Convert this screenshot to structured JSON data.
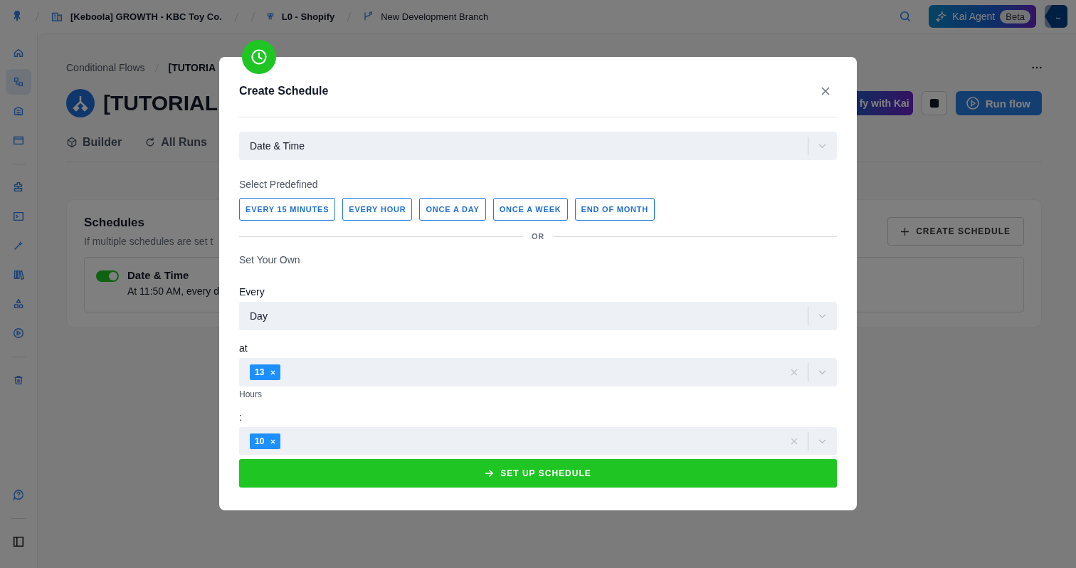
{
  "topbar": {
    "breadcrumbs": [
      {
        "kind": "org",
        "label": "[Keboola] GROWTH - KBC Toy Co."
      },
      {
        "kind": "project",
        "label": "L0 - Shopify"
      },
      {
        "kind": "branch",
        "label": "New Development Branch"
      }
    ],
    "agent_button": {
      "label": "Kai Agent",
      "badge": "Beta"
    }
  },
  "sidebar": {
    "items": [
      {
        "selected": false
      },
      {
        "selected": true
      },
      {
        "selected": false
      },
      {
        "selected": false
      },
      {
        "selected": false
      },
      {
        "selected": false
      },
      {
        "selected": false
      },
      {
        "selected": false
      },
      {
        "selected": false
      },
      {
        "selected": false
      },
      {
        "selected": false
      }
    ]
  },
  "page": {
    "breadcrumb": [
      "Conditional Flows",
      "[TUTORIA"
    ],
    "title": "[TUTORIAL",
    "tabs": [
      {
        "label": "Builder",
        "selected": false
      },
      {
        "label": "All Runs",
        "selected": false
      }
    ],
    "kai_button": "fy with Kai",
    "run_button": "Run flow",
    "schedules": {
      "title": "Schedules",
      "description": "If multiple schedules are set t",
      "create_button": "CREATE SCHEDULE",
      "items": [
        {
          "name": "Date & Time",
          "summary": "At 11:50 AM, every d",
          "on": true
        }
      ]
    }
  },
  "modal": {
    "title": "Create Schedule",
    "type_select": "Date & Time",
    "predefined_label": "Select Predefined",
    "presets": [
      "EVERY 15 MINUTES",
      "EVERY HOUR",
      "ONCE A DAY",
      "ONCE A WEEK",
      "END OF MONTH"
    ],
    "divider": "OR",
    "own_label": "Set Your Own",
    "fields": [
      {
        "kind": "select",
        "label": "Every",
        "value": "Day"
      },
      {
        "kind": "multi",
        "label": "at",
        "chips": [
          "13"
        ],
        "hint": "Hours"
      },
      {
        "kind": "multi",
        "label": ":",
        "chips": [
          "10"
        ]
      }
    ],
    "submit": "SET UP SCHEDULE"
  }
}
